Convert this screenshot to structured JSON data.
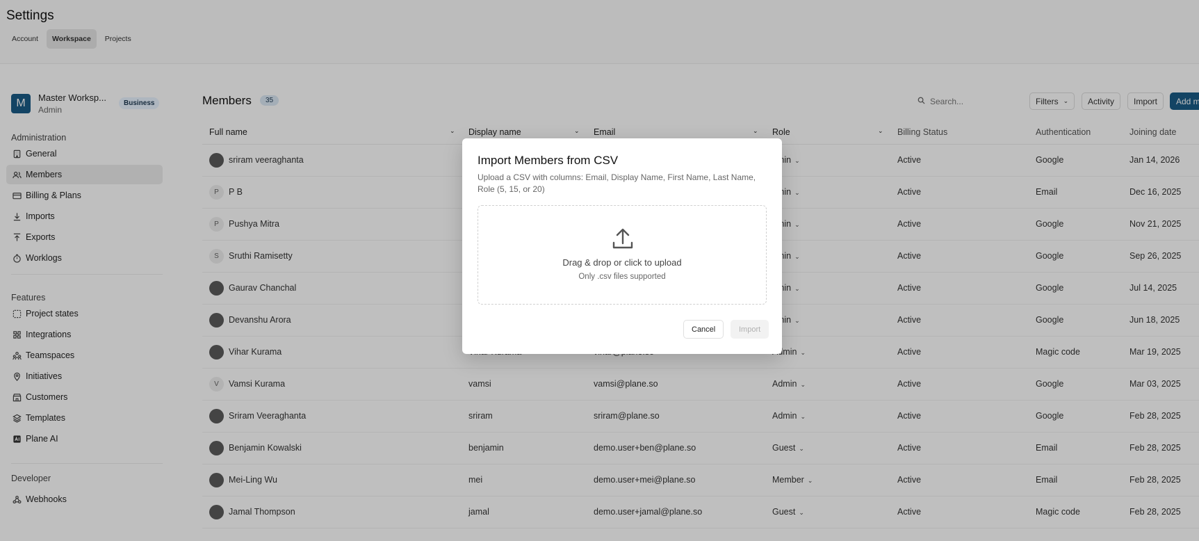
{
  "header": {
    "title": "Settings",
    "tabs": [
      {
        "label": "Account"
      },
      {
        "label": "Workspace"
      },
      {
        "label": "Projects"
      }
    ]
  },
  "workspace": {
    "logo_letter": "M",
    "name": "Master Worksp...",
    "role": "Admin",
    "plan": "Business"
  },
  "sidebar": {
    "administration_title": "Administration",
    "administration": [
      {
        "label": "General",
        "icon": "building-icon"
      },
      {
        "label": "Members",
        "icon": "users-icon"
      },
      {
        "label": "Billing & Plans",
        "icon": "credit-card-icon"
      },
      {
        "label": "Imports",
        "icon": "download-icon"
      },
      {
        "label": "Exports",
        "icon": "upload-icon"
      },
      {
        "label": "Worklogs",
        "icon": "timer-icon"
      }
    ],
    "features_title": "Features",
    "features": [
      {
        "label": "Project states",
        "icon": "dashed-square-icon"
      },
      {
        "label": "Integrations",
        "icon": "puzzle-icon"
      },
      {
        "label": "Teamspaces",
        "icon": "team-icon"
      },
      {
        "label": "Initiatives",
        "icon": "pin-icon"
      },
      {
        "label": "Customers",
        "icon": "store-icon"
      },
      {
        "label": "Templates",
        "icon": "layers-icon"
      },
      {
        "label": "Plane AI",
        "icon": "ai-icon"
      }
    ],
    "developer_title": "Developer",
    "developer": [
      {
        "label": "Webhooks",
        "icon": "webhook-icon"
      }
    ]
  },
  "members": {
    "title": "Members",
    "count": "35",
    "search_placeholder": "Search...",
    "filters_label": "Filters",
    "activity_label": "Activity",
    "import_label": "Import",
    "add_label": "Add m",
    "columns": {
      "full_name": "Full name",
      "display_name": "Display name",
      "email": "Email",
      "role": "Role",
      "billing": "Billing Status",
      "auth": "Authentication",
      "joined": "Joining date"
    },
    "rows": [
      {
        "initial": "",
        "photo": true,
        "name": "sriram veeraghanta",
        "display": "",
        "email": "",
        "role": "dmin",
        "billing": "Active",
        "auth": "Google",
        "joined": "Jan 14, 2026"
      },
      {
        "initial": "P",
        "photo": false,
        "name": "P B",
        "display": "",
        "email": "",
        "role": "dmin",
        "billing": "Active",
        "auth": "Email",
        "joined": "Dec 16, 2025"
      },
      {
        "initial": "P",
        "photo": false,
        "name": "Pushya Mitra",
        "display": "",
        "email": "",
        "role": "dmin",
        "billing": "Active",
        "auth": "Google",
        "joined": "Nov 21, 2025"
      },
      {
        "initial": "S",
        "photo": false,
        "name": "Sruthi Ramisetty",
        "display": "",
        "email": "",
        "role": "dmin",
        "billing": "Active",
        "auth": "Google",
        "joined": "Sep 26, 2025"
      },
      {
        "initial": "",
        "photo": true,
        "name": "Gaurav Chanchal",
        "display": "",
        "email": "",
        "role": "dmin",
        "billing": "Active",
        "auth": "Google",
        "joined": "Jul 14, 2025"
      },
      {
        "initial": "",
        "photo": true,
        "name": "Devanshu Arora",
        "display": "",
        "email": "",
        "role": "dmin",
        "billing": "Active",
        "auth": "Google",
        "joined": "Jun 18, 2025"
      },
      {
        "initial": "",
        "photo": true,
        "name": "Vihar Kurama",
        "display": "Vihar Kurama",
        "email": "vihar@plane.so",
        "role": "Admin",
        "billing": "Active",
        "auth": "Magic code",
        "joined": "Mar 19, 2025"
      },
      {
        "initial": "V",
        "photo": false,
        "name": "Vamsi Kurama",
        "display": "vamsi",
        "email": "vamsi@plane.so",
        "role": "Admin",
        "billing": "Active",
        "auth": "Google",
        "joined": "Mar 03, 2025"
      },
      {
        "initial": "",
        "photo": true,
        "name": "Sriram Veeraghanta",
        "display": "sriram",
        "email": "sriram@plane.so",
        "role": "Admin",
        "billing": "Active",
        "auth": "Google",
        "joined": "Feb 28, 2025"
      },
      {
        "initial": "",
        "photo": true,
        "name": "Benjamin Kowalski",
        "display": "benjamin",
        "email": "demo.user+ben@plane.so",
        "role": "Guest",
        "billing": "Active",
        "auth": "Email",
        "joined": "Feb 28, 2025"
      },
      {
        "initial": "",
        "photo": true,
        "name": "Mei-Ling Wu",
        "display": "mei",
        "email": "demo.user+mei@plane.so",
        "role": "Member",
        "billing": "Active",
        "auth": "Email",
        "joined": "Feb 28, 2025"
      },
      {
        "initial": "",
        "photo": true,
        "name": "Jamal Thompson",
        "display": "jamal",
        "email": "demo.user+jamal@plane.so",
        "role": "Guest",
        "billing": "Active",
        "auth": "Magic code",
        "joined": "Feb 28, 2025"
      }
    ]
  },
  "modal": {
    "title": "Import Members from CSV",
    "description": "Upload a CSV with columns: Email, Display Name, First Name, Last Name, Role (5, 15, or 20)",
    "drop_text": "Drag & drop or click to upload",
    "drop_sub": "Only .csv files supported",
    "cancel_label": "Cancel",
    "import_label": "Import"
  },
  "colors": {
    "brand": "#1a5b86",
    "overlay": "rgba(0,0,0,0.25)"
  }
}
